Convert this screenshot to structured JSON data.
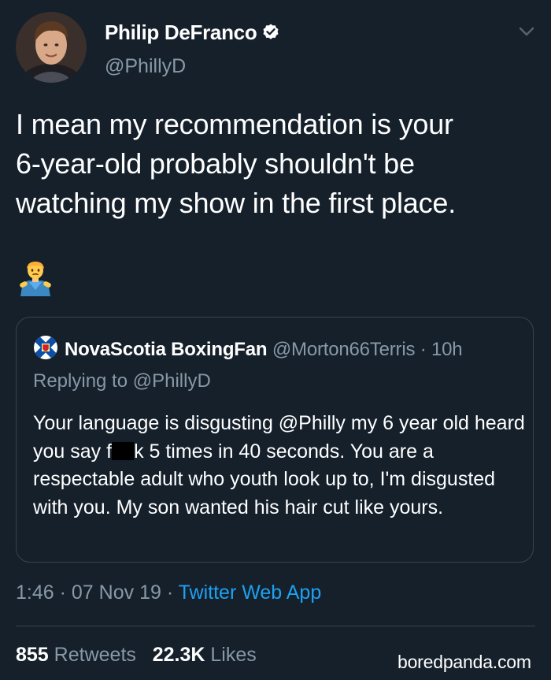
{
  "tweet": {
    "author": {
      "display_name": "Philip DeFranco",
      "handle": "@PhillyD",
      "verified": true
    },
    "text_lines": [
      "I mean my recommendation is your",
      "6-year-old probably shouldn't be",
      "watching my show in the first place."
    ],
    "emoji": "person-shrugging-emoji",
    "quoted_tweet": {
      "display_name": "NovaScotia BoxingFan",
      "handle": "@Morton66Terris",
      "time_ago": "10h",
      "separator": "·",
      "replying_to": "Replying to @PhillyD",
      "text_before_censor": "Your language is disgusting @Philly my 6 year old heard you say f",
      "text_after_censor": "k 5 times in 40 seconds. You are a respectable adult who youth look up to, I'm disgusted with you. My son wanted his hair cut like yours."
    },
    "meta": {
      "time": "1:46",
      "date": "07 Nov 19",
      "separator": "·",
      "source": "Twitter Web App"
    },
    "stats": {
      "retweets_count": "855",
      "retweets_label": "Retweets",
      "likes_count": "22.3K",
      "likes_label": "Likes"
    }
  },
  "watermark": "boredpanda.com",
  "colors": {
    "background": "#15202b",
    "text": "#ffffff",
    "secondary_text": "#8899a6",
    "link": "#1da1f2",
    "border": "#38444d"
  }
}
